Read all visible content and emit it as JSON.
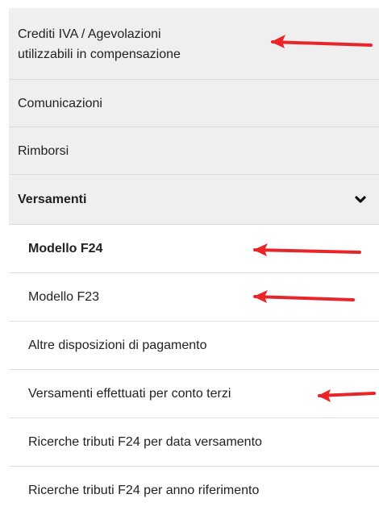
{
  "menu": {
    "items": [
      {
        "label_line1": "Crediti IVA / Agevolazioni",
        "label_line2": "utilizzabili in compensazione"
      },
      {
        "label": "Comunicazioni"
      },
      {
        "label": "Rimborsi"
      },
      {
        "label": "Versamenti",
        "expanded": true,
        "icon": "chevron-down-icon"
      }
    ],
    "subitems": [
      {
        "label": "Modello F24",
        "active": true
      },
      {
        "label": "Modello F23"
      },
      {
        "label": "Altre disposizioni di pagamento"
      },
      {
        "label": "Versamenti effettuati per conto terzi"
      },
      {
        "label": "Ricerche tributi F24 per data versamento"
      },
      {
        "label": "Ricerche tributi F24 per anno riferimento"
      }
    ]
  },
  "annotations": {
    "arrow_color": "#e8262a",
    "arrow_icon": "red-arrow-left-icon"
  },
  "colors": {
    "section_bg": "#efefef",
    "subitem_bg": "#ffffff",
    "text": "#222222"
  }
}
